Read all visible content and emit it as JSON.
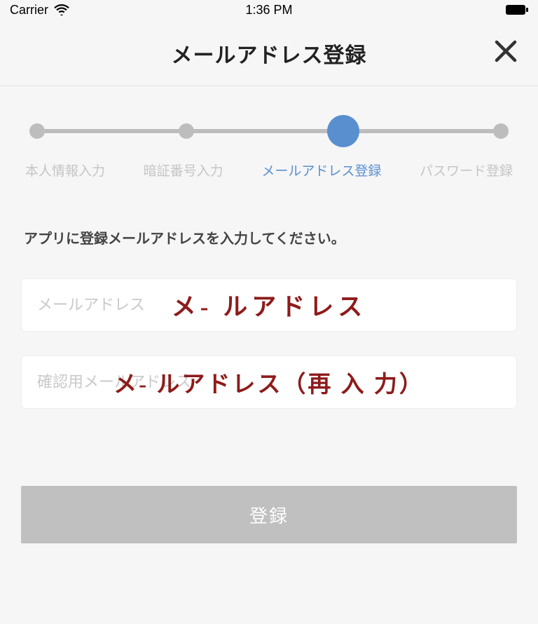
{
  "status": {
    "carrier": "Carrier",
    "time": "1:36 PM"
  },
  "header": {
    "title": "メールアドレス登録"
  },
  "progress": {
    "steps": [
      {
        "label": "本人情報入力",
        "active": false
      },
      {
        "label": "暗証番号入力",
        "active": false
      },
      {
        "label": "メールアドレス登録",
        "active": true
      },
      {
        "label": "パスワード登録",
        "active": false
      }
    ]
  },
  "instruction": "アプリに登録メールアドレスを入力してください。",
  "form": {
    "email": {
      "placeholder": "メールアドレス",
      "value": "",
      "overlay": "メ- ルアドレス"
    },
    "emailConfirm": {
      "placeholder": "確認用メールアドレス",
      "value": "",
      "overlay": "メ- ルアドレス（再 入 力）"
    }
  },
  "submit": {
    "label": "登録"
  }
}
